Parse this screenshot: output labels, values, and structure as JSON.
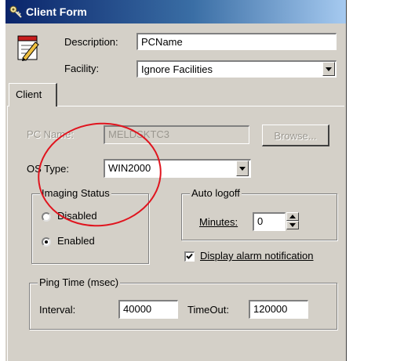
{
  "window": {
    "title": "Client Form",
    "icons": {
      "title_icon": "key-icon",
      "app_icon": "notepad-pen-icon"
    }
  },
  "header": {
    "description_label": "Description:",
    "description_value": "PCName",
    "facility_label": "Facility:",
    "facility_value": "Ignore Facilities"
  },
  "tabs": [
    {
      "label": "Client",
      "active": true
    }
  ],
  "client": {
    "pc_name_label": "PC Name:",
    "pc_name_value": "MELDSKTC3",
    "browse_label": "Browse...",
    "os_type_label": "OS Type:",
    "os_type_value": "WIN2000",
    "imaging_status": {
      "legend": "Imaging Status",
      "options": [
        {
          "label": "Disabled",
          "selected": false
        },
        {
          "label": "Enabled",
          "selected": true
        }
      ]
    },
    "auto_logoff": {
      "legend": "Auto logoff",
      "minutes_label": "Minutes:",
      "minutes_value": "0"
    },
    "display_alarm": {
      "label": "Display alarm notification",
      "checked": true
    },
    "ping_time": {
      "legend": "Ping Time (msec)",
      "interval_label": "Interval:",
      "interval_value": "40000",
      "timeout_label": "TimeOut:",
      "timeout_value": "120000"
    }
  },
  "colors": {
    "window_bg": "#d4d0c8",
    "title_gradient_start": "#0a246a",
    "title_gradient_end": "#a6caf0",
    "annotation_circle": "#e0141e"
  }
}
